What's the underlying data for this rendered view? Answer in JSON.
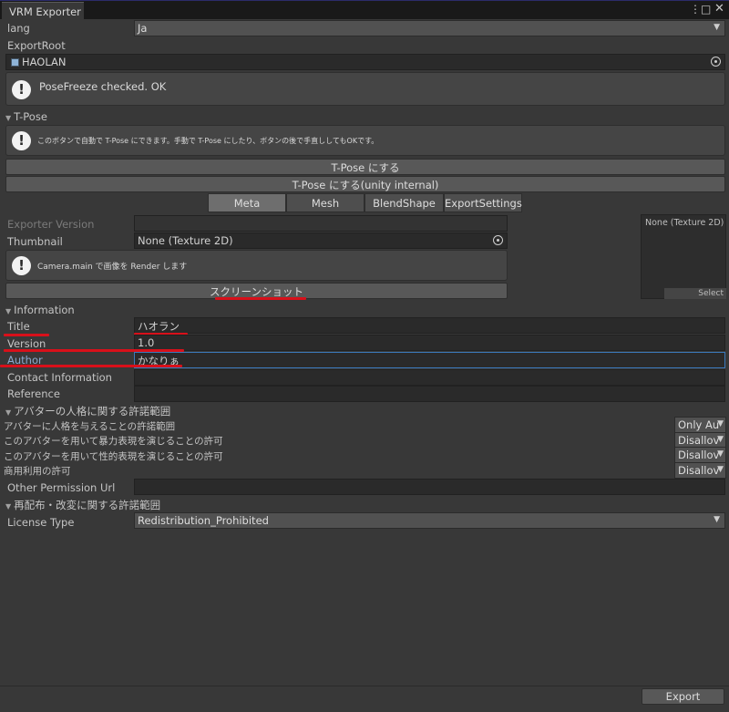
{
  "window": {
    "tab_title": "VRM Exporter",
    "menu_icon": "more-vert-icon",
    "maximize_icon": "maximize-icon",
    "close_icon": "close-icon"
  },
  "lang": {
    "label": "lang",
    "value": "Ja"
  },
  "export_root": {
    "label": "ExportRoot",
    "value": "HAOLAN",
    "icon": "gameobject-icon"
  },
  "posefreeze_help": "PoseFreeze checked. OK",
  "tpose_section": {
    "title": "T-Pose",
    "help": "このボタンで自動で T-Pose にできます。手動で T-Pose にしたり、ボタンの後で手直ししてもOKです。",
    "button1": "T-Pose にする",
    "button2": "T-Pose にする(unity internal)"
  },
  "tabs": [
    {
      "label": "Meta",
      "active": true
    },
    {
      "label": "Mesh",
      "active": false
    },
    {
      "label": "BlendShape",
      "active": false
    },
    {
      "label": "ExportSettings",
      "active": false
    }
  ],
  "meta": {
    "exporter_version_label": "Exporter Version",
    "exporter_version_value": "",
    "thumbnail_label": "Thumbnail",
    "thumbnail_value": "None (Texture 2D)",
    "camera_help": "Camera.main で画像を Render します",
    "screenshot_button": "スクリーンショット",
    "preview_label": "None (Texture 2D)",
    "preview_select": "Select"
  },
  "information": {
    "title": "Information",
    "rows": [
      {
        "label": "Title",
        "value": "ハオラン"
      },
      {
        "label": "Version",
        "value": "1.0"
      },
      {
        "label": "Author",
        "value": "かなりぁ"
      },
      {
        "label": "Contact Information",
        "value": ""
      },
      {
        "label": "Reference",
        "value": ""
      }
    ]
  },
  "personality": {
    "title": "アバターの人格に関する許諾範囲",
    "rows": [
      {
        "label": "アバターに人格を与えることの許諾範囲",
        "value": "Only Au"
      },
      {
        "label": "このアバターを用いて暴力表現を演じることの許可",
        "value": "Disallov"
      },
      {
        "label": "このアバターを用いて性的表現を演じることの許可",
        "value": "Disallov"
      },
      {
        "label": "商用利用の許可",
        "value": "Disallov"
      }
    ],
    "other_permission_label": "Other Permission Url",
    "other_permission_value": ""
  },
  "redistribution": {
    "title": "再配布・改変に関する許諾範囲",
    "license_label": "License Type",
    "license_value": "Redistribution_Prohibited"
  },
  "footer": {
    "export_button": "Export"
  },
  "colors": {
    "background": "#383838",
    "annotation_red": "#d8101a",
    "focus_blue": "#3a79bb"
  }
}
